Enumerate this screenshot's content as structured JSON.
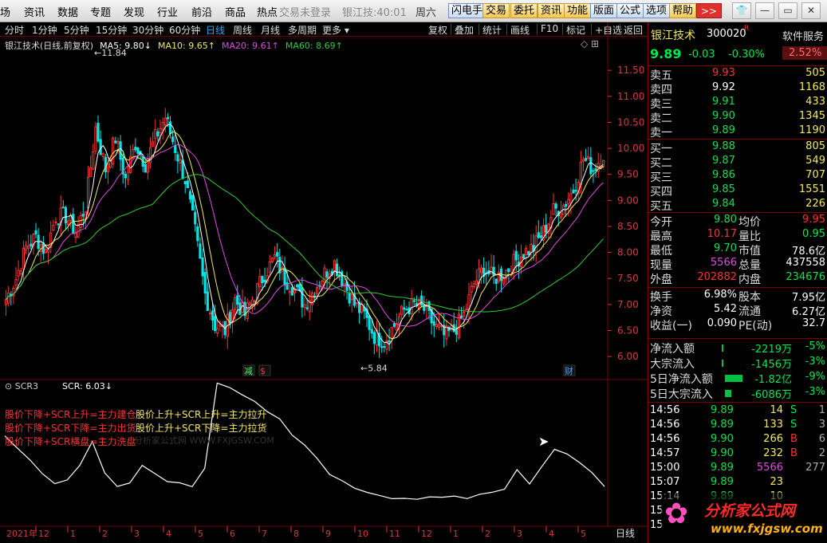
{
  "menu": [
    "场",
    "资讯",
    "数据",
    "专题",
    "发现",
    "行业",
    "前沿",
    "商品",
    "热点"
  ],
  "status": {
    "login": "交易未登录",
    "stock_time": "银江技:40:01",
    "weekday": "周六"
  },
  "toolbar": [
    {
      "label": "闪电手",
      "orange": false
    },
    {
      "label": "交易",
      "orange": true
    },
    {
      "label": "委托",
      "orange": true
    },
    {
      "label": "资讯",
      "orange": true
    },
    {
      "label": "功能",
      "orange": true
    },
    {
      "label": "版面",
      "orange": false
    },
    {
      "label": "公式",
      "orange": false
    },
    {
      "label": "选项",
      "orange": false
    },
    {
      "label": "帮助",
      "orange": true
    }
  ],
  "toolbar_more": ">>",
  "window_icons": [
    "shirt-icon",
    "minimize-icon",
    "maximize-icon",
    "close-icon"
  ],
  "window_glyphs": [
    "👕",
    "—",
    "▭",
    "✕"
  ],
  "periods": [
    "分时",
    "1分钟",
    "5分钟",
    "15分钟",
    "30分钟",
    "60分钟",
    "日线",
    "周线",
    "月线",
    "多周期",
    "更多"
  ],
  "active_period": "日线",
  "chart_tools": [
    "复权",
    "叠加",
    "统计",
    "画线",
    "F10",
    "标记",
    "+自选",
    "返回"
  ],
  "main_legend": {
    "title": "银江技术(日线,前复权)",
    "items": [
      {
        "text": "MA5: 9.80↓",
        "color": "#ffffff"
      },
      {
        "text": "MA10: 9.65↑",
        "color": "#f3e95f"
      },
      {
        "text": "MA20: 9.61↑",
        "color": "#e34be0"
      },
      {
        "text": "MA60: 8.69↑",
        "color": "#33cc33"
      }
    ]
  },
  "colors": {
    "up": "#ff3232",
    "down": "#00e5e5",
    "ma5": "#ffffff",
    "ma10": "#f3e95f",
    "ma20": "#e34be0",
    "ma60": "#33cc33",
    "grid": "#7a0000",
    "axis": "#d83a3a"
  },
  "chart_data": [
    {
      "type": "candlestick",
      "name": "银江技术 日线 前复权",
      "y_ticks": [
        6.0,
        6.5,
        7.0,
        7.5,
        8.0,
        8.5,
        9.0,
        9.5,
        10.0,
        10.5,
        11.0,
        11.5
      ],
      "ylim": [
        5.65,
        12.1
      ],
      "x_labels": [
        "2021年",
        "12",
        "1",
        "2",
        "3",
        "4",
        "5",
        "6",
        "7",
        "8",
        "9",
        "10",
        "11",
        "12",
        "1",
        "2",
        "3",
        "4",
        "5"
      ],
      "annotations": [
        {
          "text": "11.84",
          "price": 11.84
        },
        {
          "text": "5.84",
          "price": 5.84
        }
      ],
      "markers": [
        {
          "text": "减",
          "color": "#33ff66"
        },
        {
          "text": "$",
          "color": "#ff3333"
        },
        {
          "text": "财",
          "color": "#4aa3ff"
        }
      ],
      "anchors": [
        7.1,
        7.5,
        8.1,
        8.3,
        8.0,
        8.7,
        8.7,
        8.4,
        8.9,
        10.4,
        9.6,
        10.2,
        9.4,
        10.1,
        9.7,
        10.2,
        10.6,
        10.0,
        9.4,
        8.4,
        7.2,
        6.6,
        6.5,
        7.1,
        6.8,
        7.2,
        7.6,
        7.9,
        7.5,
        7.3,
        7.0,
        7.3,
        7.6,
        7.8,
        7.4,
        7.0,
        6.8,
        6.4,
        6.3,
        6.6,
        6.9,
        7.0,
        6.9,
        6.6,
        6.4,
        6.5,
        6.8,
        7.4,
        7.7,
        7.5,
        7.6,
        7.8,
        8.0,
        8.1,
        8.4,
        8.8,
        8.9,
        9.2,
        9.8,
        9.6,
        9.9
      ]
    },
    {
      "type": "line",
      "name": "SCR",
      "value": "6.03↓",
      "annotations": [
        "股价下降+SCR上升=主力建仓",
        "股价上升+SCR上升=主力拉升",
        "股价下降+SCR下降=主力出货",
        "股价上升+SCR下降=主力拉货",
        "股价下降+SCR横盘=主力洗盘"
      ],
      "anchors": [
        0.62,
        0.53,
        0.45,
        0.35,
        0.27,
        0.3,
        0.4,
        0.58,
        0.35,
        0.25,
        0.28,
        0.4,
        0.35,
        0.3,
        0.28,
        0.25,
        0.38,
        0.98,
        0.95,
        0.9,
        0.85,
        0.78,
        0.74,
        0.62,
        0.55,
        0.45,
        0.35,
        0.3,
        0.25,
        0.22,
        0.2,
        0.18,
        0.17,
        0.17,
        0.18,
        0.19,
        0.19,
        0.18,
        0.2,
        0.22,
        0.24,
        0.38,
        0.28,
        0.4,
        0.52,
        0.48,
        0.42,
        0.35,
        0.25
      ]
    }
  ],
  "sub_legend": {
    "title": "SCR3",
    "label": "SCR: 6.03↓"
  },
  "bottom_period": "日线",
  "quote": {
    "name": "银江技术",
    "code": "300020",
    "tag": "R",
    "service": "软件服务",
    "price": "9.89",
    "change": "-0.03",
    "pct": "-0.30%",
    "pct2": "2.52%"
  },
  "orderbook": [
    {
      "label": "卖五",
      "price": "9.93",
      "vol": "505",
      "side": "up"
    },
    {
      "label": "卖四",
      "price": "9.92",
      "vol": "1168",
      "side": "flat"
    },
    {
      "label": "卖三",
      "price": "9.91",
      "vol": "433",
      "side": "down"
    },
    {
      "label": "卖二",
      "price": "9.90",
      "vol": "1345",
      "side": "down"
    },
    {
      "label": "卖一",
      "price": "9.89",
      "vol": "1190",
      "side": "down"
    },
    {
      "label": "买一",
      "price": "9.88",
      "vol": "805",
      "side": "down"
    },
    {
      "label": "买二",
      "price": "9.87",
      "vol": "549",
      "side": "down"
    },
    {
      "label": "买三",
      "price": "9.86",
      "vol": "707",
      "side": "down"
    },
    {
      "label": "买四",
      "price": "9.85",
      "vol": "1551",
      "side": "down"
    },
    {
      "label": "买五",
      "price": "9.84",
      "vol": "226",
      "side": "down"
    }
  ],
  "stats": [
    {
      "l1": "今开",
      "v1": "9.80",
      "c1": "#00e64d",
      "l2": "均价",
      "v2": "9.95",
      "c2": "#ff3232"
    },
    {
      "l1": "最高",
      "v1": "10.17",
      "c1": "#ff3232",
      "l2": "量比",
      "v2": "0.95",
      "c2": "#00e64d"
    },
    {
      "l1": "最低",
      "v1": "9.70",
      "c1": "#00e64d",
      "l2": "市值",
      "v2": "78.6亿",
      "c2": "#ffffff"
    },
    {
      "l1": "现量",
      "v1": "5566",
      "c1": "#e34be0",
      "l2": "总量",
      "v2": "437558",
      "c2": "#ffffff"
    },
    {
      "l1": "外盘",
      "v1": "202882",
      "c1": "#ff3232",
      "l2": "内盘",
      "v2": "234676",
      "c2": "#00e64d"
    },
    {
      "l1": "换手",
      "v1": "6.98%",
      "c1": "#ffffff",
      "l2": "股本",
      "v2": "7.95亿",
      "c2": "#ffffff"
    },
    {
      "l1": "净资",
      "v1": "5.42",
      "c1": "#ffffff",
      "l2": "流通",
      "v2": "6.27亿",
      "c2": "#ffffff"
    },
    {
      "l1": "收益(一)",
      "v1": "0.090",
      "c1": "#ffffff",
      "l2": "PE(动)",
      "v2": "32.7",
      "c2": "#ffffff"
    }
  ],
  "flows": [
    {
      "label": "净流入额",
      "value": "-2219万",
      "pct": "-5%"
    },
    {
      "label": "大宗流入",
      "value": "-1456万",
      "pct": "-3%"
    },
    {
      "label": "5日净流入额",
      "value": "-1.82亿",
      "pct": "-9%"
    },
    {
      "label": "5日大宗流入",
      "value": "-6086万",
      "pct": "-3%"
    }
  ],
  "ticks": [
    {
      "time": "14:56",
      "price": "9.89",
      "vol": "14",
      "bs": "S",
      "n": "1",
      "pc": "#00e64d",
      "vc": "#f3e95f",
      "bc": "#00e64d"
    },
    {
      "time": "14:56",
      "price": "9.89",
      "vol": "133",
      "bs": "S",
      "n": "3",
      "pc": "#00e64d",
      "vc": "#f3e95f",
      "bc": "#00e64d"
    },
    {
      "time": "14:56",
      "price": "9.90",
      "vol": "266",
      "bs": "B",
      "n": "6",
      "pc": "#00e64d",
      "vc": "#f3e95f",
      "bc": "#ff3232"
    },
    {
      "time": "14:57",
      "price": "9.90",
      "vol": "232",
      "bs": "B",
      "n": "2",
      "pc": "#00e64d",
      "vc": "#f3e95f",
      "bc": "#ff3232"
    },
    {
      "time": "15:00",
      "price": "9.89",
      "vol": "5566",
      "bs": "",
      "n": "277",
      "pc": "#00e64d",
      "vc": "#e34be0",
      "bc": "#ffffff"
    },
    {
      "time": "15:07",
      "price": "9.89",
      "vol": "23",
      "bs": "",
      "n": "",
      "pc": "#00e64d",
      "vc": "#f3e95f",
      "bc": "#ffffff"
    },
    {
      "time": "15:14",
      "price": "9.89",
      "vol": "10",
      "bs": "",
      "n": "",
      "pc": "#00e64d",
      "vc": "#f3e95f",
      "bc": "#ffffff"
    },
    {
      "time": "15",
      "price": "",
      "vol": "",
      "bs": "",
      "n": "",
      "pc": "#00e64d",
      "vc": "#f3e95f",
      "bc": "#ffffff"
    },
    {
      "time": "15",
      "price": "",
      "vol": "",
      "bs": "",
      "n": "",
      "pc": "#00e64d",
      "vc": "#f3e95f",
      "bc": "#ffffff"
    }
  ],
  "watermark": {
    "brand": "分析家公式网",
    "url": "www.fxjgsw.com",
    "faint": "分析家公式网 WWW.FXJGSW.COM"
  }
}
